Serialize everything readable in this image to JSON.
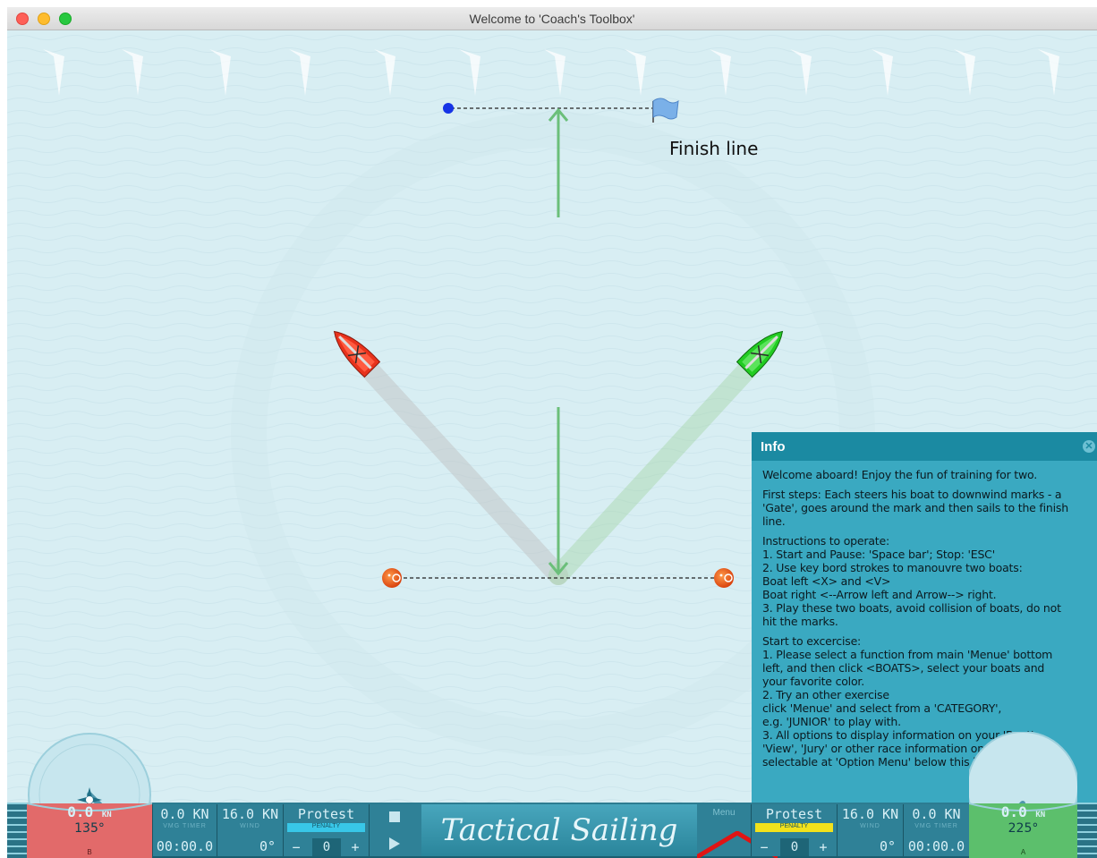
{
  "window": {
    "title": "Welcome to 'Coach's Toolbox'"
  },
  "course": {
    "finish_label": "Finish line",
    "colors": {
      "water": "#d8eef3",
      "red_boat": "#e8321c",
      "green_boat": "#22cc22",
      "arrow": "#6bbf7a",
      "mark": "#e85a18",
      "pin": "#1634e6",
      "flag": "#7ab0e8"
    }
  },
  "info": {
    "title": "Info",
    "close_icon": "close-icon",
    "paragraphs": [
      [
        "Welcome aboard! Enjoy the fun of training for two."
      ],
      [
        "First steps: Each steers his boat to downwind marks - a",
        "'Gate', goes around the mark and then sails to the finish",
        "line."
      ],
      [
        "Instructions to operate:",
        "1. Start and Pause: 'Space bar'; Stop: 'ESC'",
        "2. Use key bord strokes to manouvre two boats:",
        "Boat left <X> and <V>",
        "Boat right <--Arrow left and Arrow--> right.",
        "3. Play these two boats, avoid collision of boats, do not",
        "hit the marks."
      ],
      [
        "Start to excercise:",
        "1. Please select a function from main 'Menue' bottom",
        "left, and then click <BOATS>, select your boats and",
        "your favorite color.",
        "2. Try an other exercise",
        "click 'Menue' and select from a 'CATEGORY',",
        "e.g. 'JUNIOR' to play with.",
        "3. All options to display information on your 'Boat',",
        "'View', 'Jury' or other race information on water are",
        "selectable at 'Option Menu' below this info window."
      ]
    ]
  },
  "dashboard": {
    "left": {
      "gauge_speed": "0.0",
      "gauge_unit": "KN",
      "gauge_heading": "135°",
      "gauge_color": "#e26a6a",
      "boat_letter": "B",
      "speed": "0.0 KN",
      "vmg_timer_label": "VMG TIMER",
      "timer": "00:00.0",
      "wind_speed": "16.0 KN",
      "wind_label": "WIND",
      "wind_dir": "0°",
      "protest": "Protest",
      "penalty_label": "PENALTY",
      "penalty_color": "#38c7e8",
      "penalty_value": "0"
    },
    "stop_icon": "stop-icon",
    "play_icon": "play-icon",
    "brand": "Tactical Sailing",
    "menu_label": "Menu",
    "right": {
      "protest": "Protest",
      "penalty_label": "PENALTY",
      "penalty_color": "#f2e21c",
      "penalty_value": "0",
      "wind_speed": "16.0 KN",
      "wind_label": "WIND",
      "wind_dir": "0°",
      "speed": "0.0 KN",
      "vmg_timer_label": "VMG TIMER",
      "timer": "00:00.0",
      "gauge_speed": "0.0",
      "gauge_unit": "KN",
      "gauge_heading": "225°",
      "gauge_color": "#5cbf6c",
      "boat_letter": "A"
    },
    "minus": "−",
    "plus": "+"
  }
}
